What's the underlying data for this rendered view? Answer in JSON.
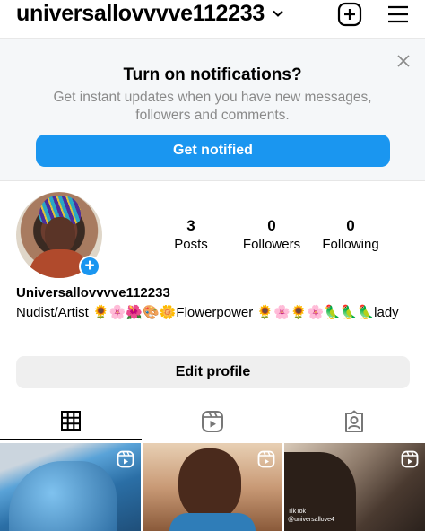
{
  "header": {
    "username": "universallovvvve112233",
    "icons": {
      "chevron": "chevron-down-icon",
      "add": "plus-square-icon",
      "menu": "hamburger-menu-icon"
    }
  },
  "notification_prompt": {
    "title": "Turn on notifications?",
    "description": "Get instant updates when you have new messages, followers and comments.",
    "button_label": "Get notified",
    "close_icon": "close-icon",
    "accent_color": "#1a96f0"
  },
  "profile": {
    "avatar_icon": "add-story-plus-icon",
    "stats": [
      {
        "value": "3",
        "label": "Posts"
      },
      {
        "value": "0",
        "label": "Followers"
      },
      {
        "value": "0",
        "label": "Following"
      }
    ],
    "display_name": "Universallovvvve112233",
    "bio": "Nudist/Artist 🌻🌸🌺🎨🌼Flowerpower 🌻🌸🌻🌸🦜🦜🦜lady",
    "edit_button_label": "Edit profile"
  },
  "tabs": [
    {
      "name": "posts-grid",
      "icon": "grid-icon",
      "active": true
    },
    {
      "name": "reels",
      "icon": "reels-icon",
      "active": false
    },
    {
      "name": "tagged",
      "icon": "tagged-person-icon",
      "active": false
    }
  ],
  "grid_posts": [
    {
      "type": "reel",
      "icon": "reel-badge-icon"
    },
    {
      "type": "reel",
      "icon": "reel-badge-icon"
    },
    {
      "type": "reel",
      "icon": "reel-badge-icon",
      "watermark_brand": "TikTok",
      "watermark_handle": "@universallove4"
    }
  ]
}
